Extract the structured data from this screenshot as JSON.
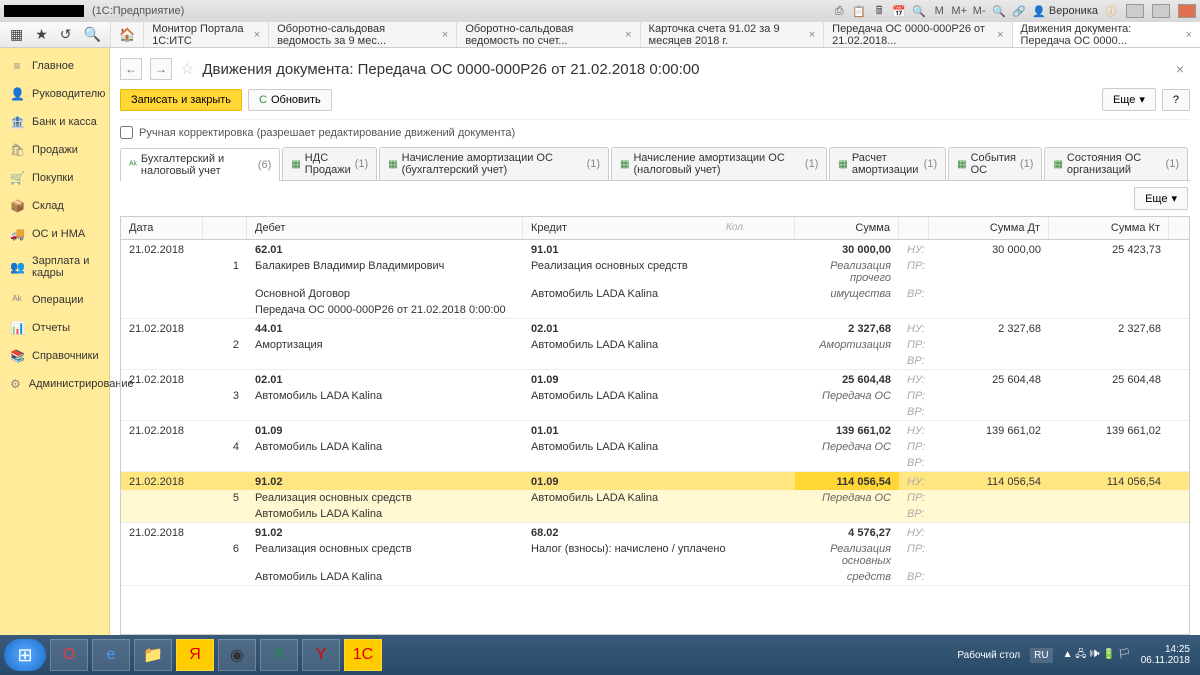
{
  "titlebar": {
    "app_suffix": "(1С:Предприятие)",
    "user": "Вероника",
    "m_labels": [
      "М",
      "М+",
      "М-"
    ]
  },
  "panel": {
    "tabs": [
      {
        "label": "Монитор Портала 1С:ИТС"
      },
      {
        "label": "Оборотно-сальдовая ведомость за 9 мес..."
      },
      {
        "label": "Оборотно-сальдовая ведомость по счет..."
      },
      {
        "label": "Карточка счета 91.02 за 9 месяцев 2018 г."
      },
      {
        "label": "Передача ОС 0000-000Р26 от 21.02.2018..."
      },
      {
        "label": "Движения документа: Передача ОС 0000..."
      }
    ]
  },
  "sidebar": {
    "items": [
      {
        "icon": "≡",
        "label": "Главное"
      },
      {
        "icon": "👤",
        "label": "Руководителю"
      },
      {
        "icon": "🏦",
        "label": "Банк и касса"
      },
      {
        "icon": "🛍",
        "label": "Продажи"
      },
      {
        "icon": "🛒",
        "label": "Покупки"
      },
      {
        "icon": "📦",
        "label": "Склад"
      },
      {
        "icon": "🚚",
        "label": "ОС и НМА"
      },
      {
        "icon": "👥",
        "label": "Зарплата и кадры"
      },
      {
        "icon": "ᴬᵏ",
        "label": "Операции"
      },
      {
        "icon": "📊",
        "label": "Отчеты"
      },
      {
        "icon": "📚",
        "label": "Справочники"
      },
      {
        "icon": "⚙",
        "label": "Администрирование"
      }
    ]
  },
  "doc": {
    "title": "Движения документа: Передача ОС 0000-000Р26 от 21.02.2018 0:00:00",
    "save_close": "Записать и закрыть",
    "refresh": "Обновить",
    "more": "Еще",
    "manual_edit": "Ручная корректировка (разрешает редактирование движений документа)"
  },
  "inner_tabs": [
    {
      "label": "Бухгалтерский и налоговый учет",
      "count": "(6)"
    },
    {
      "label": "НДС Продажи",
      "count": "(1)"
    },
    {
      "label": "Начисление амортизации ОС (бухгалтерский учет)",
      "count": "(1)"
    },
    {
      "label": "Начисление амортизации ОС (налоговый учет)",
      "count": "(1)"
    },
    {
      "label": "Расчет амортизации",
      "count": "(1)"
    },
    {
      "label": "События ОС",
      "count": "(1)"
    },
    {
      "label": "Состояния ОС организаций",
      "count": "(1)"
    }
  ],
  "grid": {
    "headers": {
      "date": "Дата",
      "debit": "Дебет",
      "credit": "Кредит",
      "sum": "Сумма",
      "sumdt": "Сумма Дт",
      "sumkt": "Сумма Кт",
      "kol": "Кол."
    },
    "types": {
      "nu": "НУ:",
      "pr": "ПР:",
      "vr": "ВР:"
    }
  },
  "entries": [
    {
      "date": "21.02.2018",
      "n": "1",
      "dt": "62.01",
      "kt": "91.01",
      "sum": "30 000,00",
      "sumdt": "30 000,00",
      "sumkt": "25 423,73",
      "dlines": [
        "Балакирев Владимир Владимирович",
        "Основной Договор",
        "Передача ОС 0000-000Р26 от 21.02.2018 0:00:00"
      ],
      "klines": [
        "Реализация основных средств",
        "Автомобиль LADA Kalina"
      ],
      "slines": [
        "Реализация прочего",
        "имущества"
      ]
    },
    {
      "date": "21.02.2018",
      "n": "2",
      "dt": "44.01",
      "kt": "02.01",
      "sum": "2 327,68",
      "sumdt": "2 327,68",
      "sumkt": "2 327,68",
      "dlines": [
        "Амортизация"
      ],
      "klines": [
        "Автомобиль LADA Kalina"
      ],
      "slines": [
        "Амортизация"
      ]
    },
    {
      "date": "21.02.2018",
      "n": "3",
      "dt": "02.01",
      "kt": "01.09",
      "sum": "25 604,48",
      "sumdt": "25 604,48",
      "sumkt": "25 604,48",
      "dlines": [
        "Автомобиль LADA Kalina"
      ],
      "klines": [
        "Автомобиль LADA Kalina"
      ],
      "slines": [
        "Передача ОС"
      ]
    },
    {
      "date": "21.02.2018",
      "n": "4",
      "dt": "01.09",
      "kt": "01.01",
      "sum": "139 661,02",
      "sumdt": "139 661,02",
      "sumkt": "139 661,02",
      "dlines": [
        "Автомобиль LADA Kalina"
      ],
      "klines": [
        "Автомобиль LADA Kalina"
      ],
      "slines": [
        "Передача ОС"
      ]
    },
    {
      "date": "21.02.2018",
      "n": "5",
      "dt": "91.02",
      "kt": "01.09",
      "sum": "114 056,54",
      "sumdt": "114 056,54",
      "sumkt": "114 056,54",
      "dlines": [
        "Реализация основных средств",
        "Автомобиль LADA Kalina"
      ],
      "klines": [
        "Автомобиль LADA Kalina"
      ],
      "slines": [
        "Передача ОС"
      ],
      "selected": true
    },
    {
      "date": "21.02.2018",
      "n": "6",
      "dt": "91.02",
      "kt": "68.02",
      "sum": "4 576,27",
      "sumdt": "",
      "sumkt": "",
      "dlines": [
        "Реализация основных средств",
        "Автомобиль LADA Kalina"
      ],
      "klines": [
        "Налог (взносы): начислено / уплачено"
      ],
      "slines": [
        "Реализация основных",
        "средств"
      ]
    }
  ],
  "taskbar": {
    "desktop": "Рабочий стол",
    "lang": "RU",
    "time": "14:25",
    "date": "06.11.2018"
  }
}
